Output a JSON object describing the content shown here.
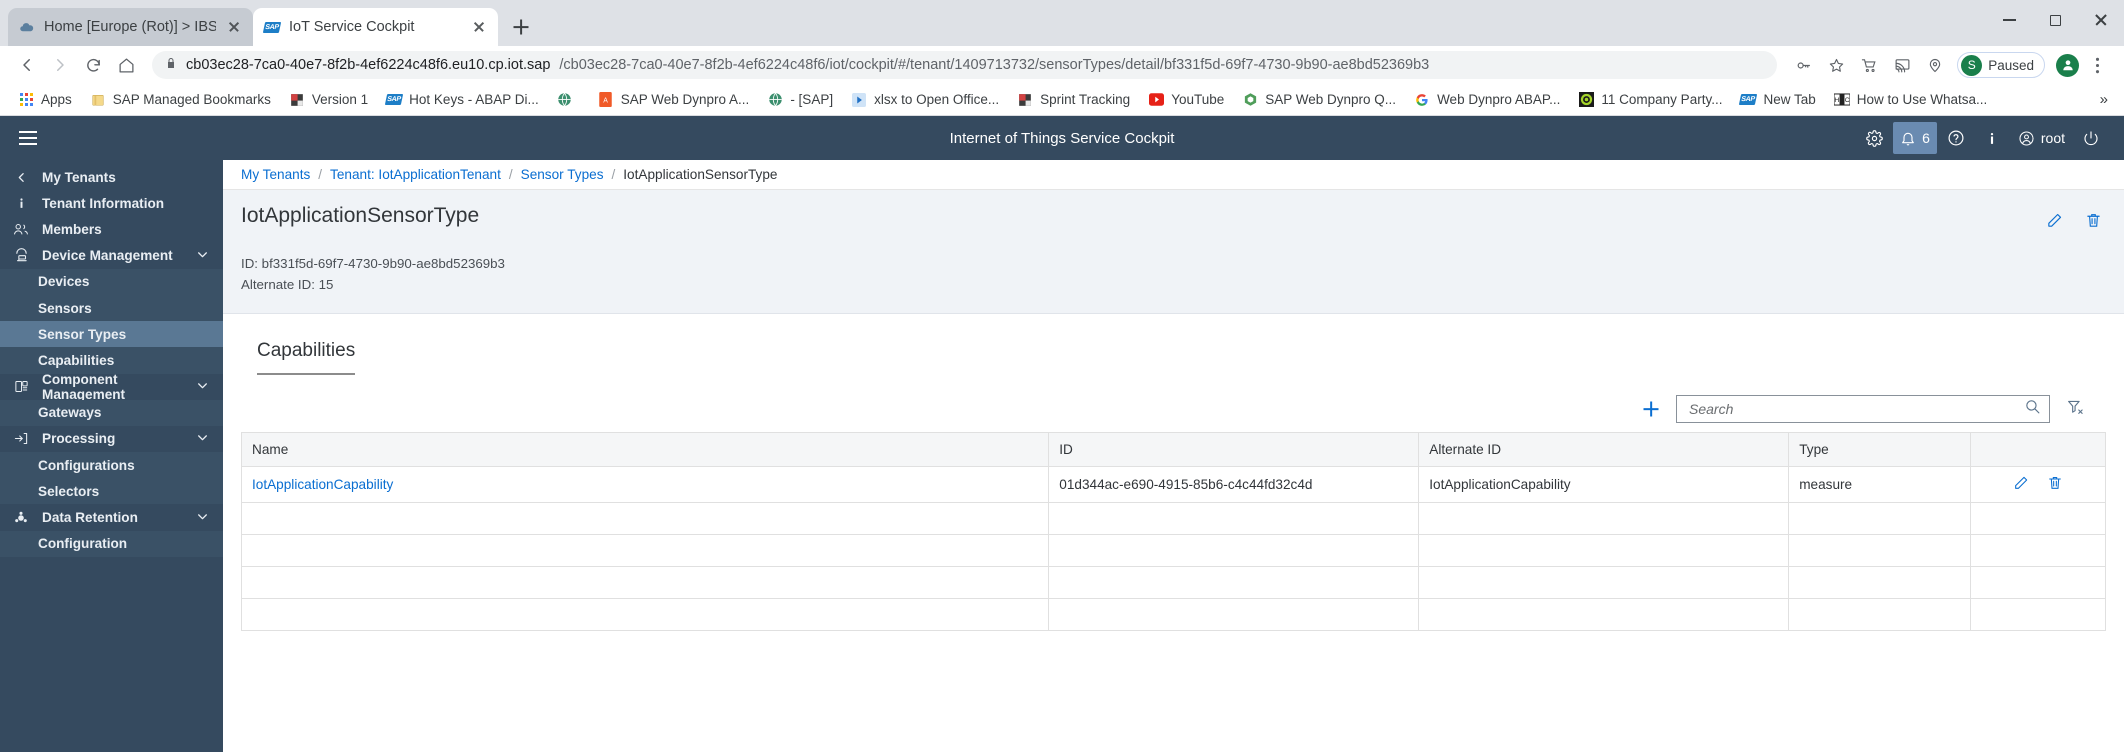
{
  "browser": {
    "tabs": [
      {
        "title": "Home [Europe (Rot)] > IBSO-ATC",
        "favicon": "cloud-icon",
        "active": false
      },
      {
        "title": "IoT Service Cockpit",
        "favicon": "sap-icon",
        "active": true
      }
    ],
    "new_tab_label": "+",
    "url_host": "cb03ec28-7ca0-40e7-8f2b-4ef6224c48f6.eu10.cp.iot.sap",
    "url_path": "/cb03ec28-7ca0-40e7-8f2b-4ef6224c48f6/iot/cockpit/#/tenant/1409713732/sensorTypes/detail/bf331f5d-69f7-4730-9b90-ae8bd52369b3",
    "profile_status": "Paused",
    "profile_initial": "S",
    "bookmarks": [
      {
        "label": "Apps",
        "icon": "apps-grid-icon"
      },
      {
        "label": "SAP Managed Bookmarks",
        "icon": "folder-icon"
      },
      {
        "label": "Version 1",
        "icon": "flag-icon"
      },
      {
        "label": "Hot Keys - ABAP Di...",
        "icon": "sap-icon"
      },
      {
        "label": "",
        "icon": "globe-icon"
      },
      {
        "label": "SAP Web Dynpro A...",
        "icon": "pdf-icon"
      },
      {
        "label": "- [SAP]",
        "icon": "globe-icon"
      },
      {
        "label": "xlsx to Open Office...",
        "icon": "play-icon"
      },
      {
        "label": "Sprint Tracking",
        "icon": "flag-icon"
      },
      {
        "label": "YouTube",
        "icon": "youtube-icon"
      },
      {
        "label": "SAP Web Dynpro Q...",
        "icon": "hex-icon"
      },
      {
        "label": "Web Dynpro ABAP...",
        "icon": "google-icon"
      },
      {
        "label": "11 Company Party...",
        "icon": "target-icon"
      },
      {
        "label": "New Tab",
        "icon": "sap-icon"
      },
      {
        "label": "How to Use Whatsa...",
        "icon": "htc-icon"
      }
    ],
    "overflow_label": "»"
  },
  "app": {
    "title": "Internet of Things Service Cockpit",
    "header_actions": {
      "settings": "gear-icon",
      "notifications_count": "6",
      "help": "help-icon",
      "info": "info-icon",
      "user": "root",
      "logout": "power-icon"
    }
  },
  "sidebar": {
    "items": [
      {
        "label": "My Tenants",
        "icon": "chevron-left-icon",
        "level": "top",
        "chevron": false,
        "selected": false
      },
      {
        "label": "Tenant Information",
        "icon": "info-icon",
        "level": "top",
        "chevron": false,
        "selected": false
      },
      {
        "label": "Members",
        "icon": "members-icon",
        "level": "top",
        "chevron": false,
        "selected": false
      },
      {
        "label": "Device Management",
        "icon": "device-icon",
        "level": "top",
        "chevron": true,
        "selected": false
      },
      {
        "label": "Devices",
        "icon": "",
        "level": "sub",
        "chevron": false,
        "selected": false
      },
      {
        "label": "Sensors",
        "icon": "",
        "level": "sub",
        "chevron": false,
        "selected": false
      },
      {
        "label": "Sensor Types",
        "icon": "",
        "level": "sub",
        "chevron": false,
        "selected": true
      },
      {
        "label": "Capabilities",
        "icon": "",
        "level": "sub",
        "chevron": false,
        "selected": false
      },
      {
        "label": "Component Management",
        "icon": "component-icon",
        "level": "top",
        "chevron": true,
        "selected": false
      },
      {
        "label": "Gateways",
        "icon": "",
        "level": "sub",
        "chevron": false,
        "selected": false
      },
      {
        "label": "Processing",
        "icon": "processing-icon",
        "level": "top",
        "chevron": true,
        "selected": false
      },
      {
        "label": "Configurations",
        "icon": "",
        "level": "sub",
        "chevron": false,
        "selected": false
      },
      {
        "label": "Selectors",
        "icon": "",
        "level": "sub",
        "chevron": false,
        "selected": false
      },
      {
        "label": "Data Retention",
        "icon": "retention-icon",
        "level": "top",
        "chevron": true,
        "selected": false
      },
      {
        "label": "Configuration",
        "icon": "",
        "level": "sub",
        "chevron": false,
        "selected": false
      }
    ]
  },
  "breadcrumb": {
    "items": [
      {
        "label": "My Tenants",
        "link": true
      },
      {
        "label": "Tenant: IotApplicationTenant",
        "link": true
      },
      {
        "label": "Sensor Types",
        "link": true
      },
      {
        "label": "IotApplicationSensorType",
        "link": false
      }
    ],
    "separator": "/"
  },
  "detail": {
    "title": "IotApplicationSensorType",
    "id_line": "ID: bf331f5d-69f7-4730-9b90-ae8bd52369b3",
    "alternate_id_line": "Alternate ID: 15",
    "edit_icon": "pencil-icon",
    "delete_icon": "trash-icon"
  },
  "capabilities": {
    "section_title": "Capabilities",
    "add_label": "+",
    "search_placeholder": "Search",
    "search_value": "",
    "search_icon": "magnifier-icon",
    "filter_icon": "clear-filter-icon",
    "columns": [
      "Name",
      "ID",
      "Alternate ID",
      "Type",
      ""
    ],
    "rows": [
      {
        "name": "IotApplicationCapability",
        "id": "01d344ac-e690-4915-85b6-c4c44fd32c4d",
        "alternate_id": "IotApplicationCapability",
        "type": "measure",
        "edit_icon": "pencil-icon",
        "delete_icon": "trash-icon"
      }
    ],
    "empty_row_count": 4
  },
  "colors": {
    "brand_dark": "#354a5f",
    "accent_link": "#0a6ed1",
    "selected_nav": "#5a7894"
  }
}
